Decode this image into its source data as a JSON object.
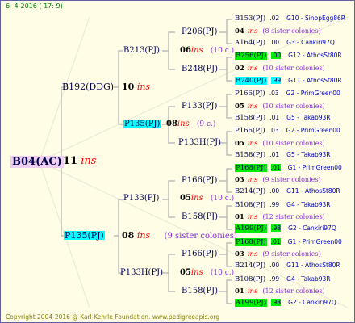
{
  "header": "6-  4-2016 ( 17:  9)",
  "footer": "Copyright 2004-2016 @ Karl Kehrle Foundation.   www.pedigreeapis.org",
  "root": {
    "label": "B04(AC)",
    "num": "11",
    "ins": "ins"
  },
  "sire": {
    "label": "B192(DDG)",
    "num": "10",
    "ins": "ins"
  },
  "dam": {
    "label": "P135(PJ)",
    "num": "08",
    "ins": "ins",
    "note": "(9 sister colonies)"
  },
  "gen3": [
    {
      "label": "B213(PJ)"
    },
    {
      "label": "P135(PJ)",
      "num": "08",
      "ins": "ins",
      "note": "(9 c.)"
    },
    {
      "label": "P133(PJ)"
    },
    {
      "label": "P133H(PJ)",
      "num": "05",
      "ins": "ins",
      "note": "(10 c.)"
    }
  ],
  "gen4": [
    {
      "label": "P206(PJ)",
      "num": "06",
      "ins": "ins",
      "note": "(10 c.)"
    },
    {
      "label": "B248(PJ)"
    },
    {
      "label": "P133(PJ)"
    },
    {
      "label": "P133H(PJ)"
    },
    {
      "label": "P166(PJ)"
    },
    {
      "label": "B158(PJ)"
    },
    {
      "label": "P166(PJ)"
    },
    {
      "label": "B158(PJ)"
    }
  ],
  "p133_mid": {
    "num": "05",
    "ins": "ins",
    "note": "(10 c.)"
  },
  "gen5": [
    {
      "label": "B153(PJ)",
      "score": ".02",
      "link": "G10 - SinopEgg86R"
    },
    {
      "num": "04",
      "ins": "ins",
      "note": "(8 sister colonies)"
    },
    {
      "label": "A164(PJ)",
      "score": ".00",
      "link": "G3 - Cankiri97Q"
    },
    {
      "label": "B256(PJ)",
      "score": ".00",
      "link": "G12 - AthosSt80R"
    },
    {
      "num": "02",
      "ins": "ins",
      "note": "(10 sister colonies)"
    },
    {
      "label": "B240(PJ)",
      "score": ".99",
      "link": "G11 - AthosSt80R"
    },
    {
      "label": "P166(PJ)",
      "score": ".03",
      "link": "G2 - PrimGreen00"
    },
    {
      "num": "05",
      "ins": "ins",
      "note": "(10 sister colonies)"
    },
    {
      "label": "B158(PJ)",
      "score": ".01",
      "link": "G5 - Takab93R"
    },
    {
      "label": "P166(PJ)",
      "score": ".03",
      "link": "G2 - PrimGreen00"
    },
    {
      "num": "05",
      "ins": "ins",
      "note": "(10 sister colonies)"
    },
    {
      "label": "B158(PJ)",
      "score": ".01",
      "link": "G5 - Takab93R"
    },
    {
      "label": "P168(PJ)",
      "score": ".01",
      "link": "G1 - PrimGreen00"
    },
    {
      "num": "03",
      "ins": "ins",
      "note": "(9 sister colonies)"
    },
    {
      "label": "B214(PJ)",
      "score": ".00",
      "link": "G11 - AthosSt80R"
    },
    {
      "label": "B108(PJ)",
      "score": ".99",
      "link": "G4 - Takab93R"
    },
    {
      "num": "01",
      "ins": "ins",
      "note": "(12 sister colonies)"
    },
    {
      "label": "A199(PJ)",
      "score": ".98",
      "link": "G2 - Cankiri97Q"
    },
    {
      "label": "P168(PJ)",
      "score": ".01",
      "link": "G1 - PrimGreen00"
    },
    {
      "num": "03",
      "ins": "ins",
      "note": "(9 sister colonies)"
    },
    {
      "label": "B214(PJ)",
      "score": ".00",
      "link": "G11 - AthosSt80R"
    },
    {
      "label": "B108(PJ)",
      "score": ".99",
      "link": "G4 - Takab93R"
    },
    {
      "num": "01",
      "ins": "ins",
      "note": "(12 sister colonies)"
    },
    {
      "label": "A199(PJ)",
      "score": ".98",
      "link": "G2 - Cankiri97Q"
    }
  ]
}
